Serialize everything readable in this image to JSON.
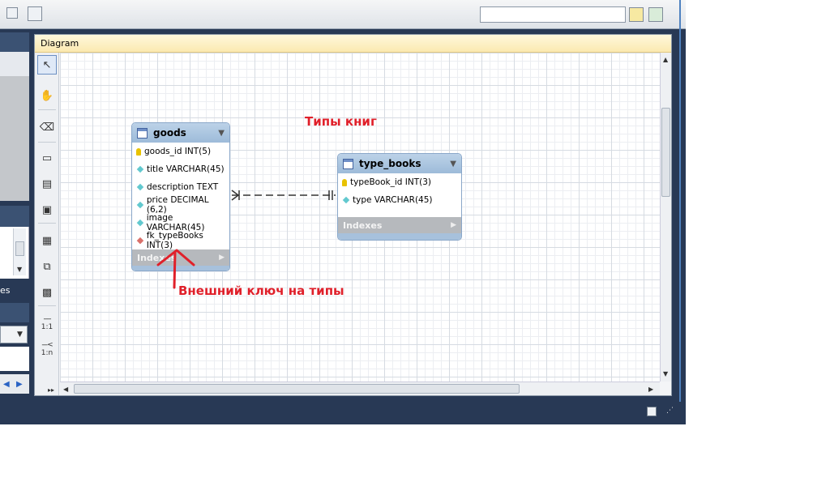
{
  "panel": {
    "title": "Diagram"
  },
  "left": {
    "partial_label": "es",
    "rel_one_one": "1:1",
    "rel_one_n": "1:n"
  },
  "annotations": {
    "types_title": "Типы книг",
    "fk_note": "Внешний ключ на типы"
  },
  "tables": {
    "goods": {
      "name": "goods",
      "columns": [
        {
          "label": "goods_id INT(5)",
          "kind": "pk"
        },
        {
          "label": "title VARCHAR(45)",
          "kind": "col"
        },
        {
          "label": "description TEXT",
          "kind": "col"
        },
        {
          "label": "price DECIMAL (6,2)",
          "kind": "col"
        },
        {
          "label": "image VARCHAR(45)",
          "kind": "col"
        },
        {
          "label": "fk_typeBooks INT(3)",
          "kind": "fk"
        }
      ],
      "indexes_label": "Indexes"
    },
    "type_books": {
      "name": "type_books",
      "columns": [
        {
          "label": "typeBook_id INT(3)",
          "kind": "pk"
        },
        {
          "label": "type VARCHAR(45)",
          "kind": "col"
        }
      ],
      "indexes_label": "Indexes"
    }
  },
  "colors": {
    "annotation": "#e0202a",
    "header": "#283955",
    "table_head": "#a6c2e0"
  }
}
